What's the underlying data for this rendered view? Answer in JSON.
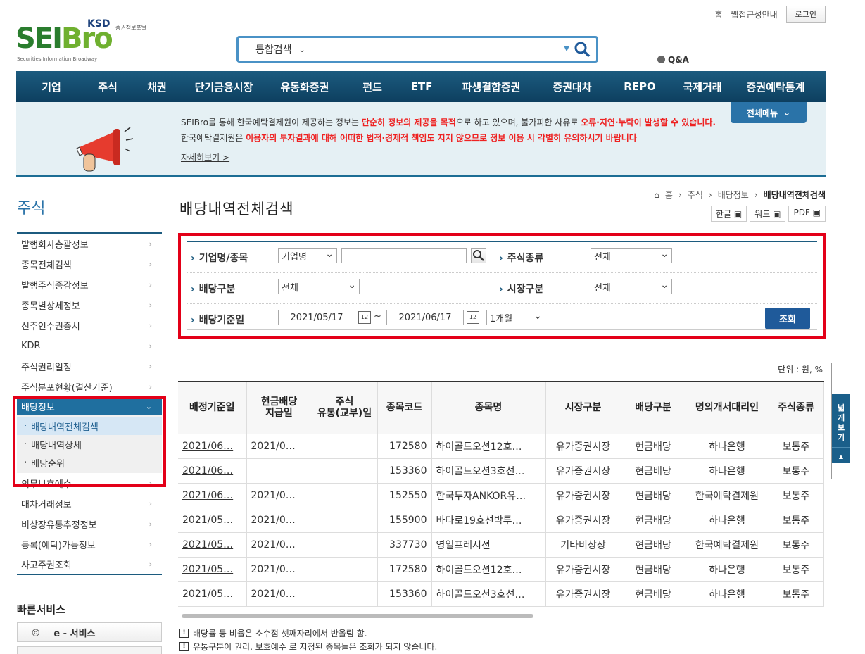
{
  "top": {
    "home": "홈",
    "accessibility": "웹접근성안내",
    "login": "로그인"
  },
  "logo": {
    "text_a": "SEI",
    "text_b": "Bro",
    "ksd": "KSD",
    "ksd_sub": "증권정보포털",
    "tagline": "Securities Information Broadway"
  },
  "search": {
    "scope": "통합검색"
  },
  "qa": "Q&A",
  "gnb": [
    "기업",
    "주식",
    "채권",
    "단기금융시장",
    "유동화증권",
    "펀드",
    "ETF",
    "파생결합증권",
    "증권대차",
    "REPO",
    "국제거래",
    "증권예탁통계"
  ],
  "notice": {
    "l1a": "SEIBro를 통해 한국예탁결제원이 제공하는 정보는 ",
    "l1b": "단순히 정보의 제공을 목적",
    "l1c": "으로 하고 있으며, 불가피한 사유로 ",
    "l1d": "오류·지연·누락이 발생할 수 있습니다.",
    "l2a": "한국예탁결제원은 ",
    "l2b": "이용자의 투자결과에 대해 어떠한 법적·경제적 책임도 지지 않으므로 정보 이용 시 각별히 유의하시기 바랍니다",
    "more": "자세히보기  >",
    "all_menu": "전체메뉴"
  },
  "lnb": {
    "title": "주식",
    "items": [
      "발행회사총괄정보",
      "종목전체검색",
      "발행주식증감정보",
      "종목별상세정보",
      "신주인수권증서",
      "KDR",
      "주식권리일정",
      "주식분포현황(결산기준)"
    ],
    "active": "배당정보",
    "sub": [
      "배당내역전체검색",
      "배당내역상세",
      "배당순위"
    ],
    "items2": [
      "의무보호예수",
      "대차거래정보",
      "비상장유통추정정보",
      "등록(예탁)가능정보",
      "사고주권조회"
    ]
  },
  "quick": {
    "title": "빠른서비스",
    "eservice": "e - 서비스"
  },
  "page": {
    "title": "배당내역전체검색"
  },
  "breadcrumb": {
    "home": "홈",
    "c1": "주식",
    "c2": "배당정보",
    "current": "배당내역전체검색"
  },
  "exports": [
    "한글",
    "워드",
    "PDF"
  ],
  "filter": {
    "company_label": "기업명/종목",
    "company_type": "기업명",
    "company_value": "",
    "stock_kind_label": "주식종류",
    "stock_kind": "전체",
    "div_type_label": "배당구분",
    "div_type": "전체",
    "market_label": "시장구분",
    "market": "전체",
    "date_label": "배당기준일",
    "date_from": "2021/05/17",
    "tilde": "~",
    "date_to": "2021/06/17",
    "period": "1개월",
    "search_btn": "조회"
  },
  "unit": "단위 : 원, %",
  "table": {
    "headers": [
      [
        "배정기준일"
      ],
      [
        "현금배당",
        "지급일"
      ],
      [
        "주식",
        "유통(교부)일"
      ],
      [
        "종목코드"
      ],
      [
        "종목명"
      ],
      [
        "시장구분"
      ],
      [
        "배당구분"
      ],
      [
        "명의개서대리인"
      ],
      [
        "주식종류"
      ]
    ],
    "rows": [
      [
        "2021/06…",
        "2021/0…",
        "",
        "172580",
        "하이골드오션12호…",
        "유가증권시장",
        "현금배당",
        "하나은행",
        "보통주"
      ],
      [
        "2021/06…",
        "",
        "",
        "153360",
        "하이골드오션3호선…",
        "유가증권시장",
        "현금배당",
        "하나은행",
        "보통주"
      ],
      [
        "2021/06…",
        "2021/0…",
        "",
        "152550",
        "한국투자ANKOR유…",
        "유가증권시장",
        "현금배당",
        "한국예탁결제원",
        "보통주"
      ],
      [
        "2021/05…",
        "2021/0…",
        "",
        "155900",
        "바다로19호선박투…",
        "유가증권시장",
        "현금배당",
        "하나은행",
        "보통주"
      ],
      [
        "2021/05…",
        "2021/0…",
        "",
        "337730",
        "영일프레시젼",
        "기타비상장",
        "현금배당",
        "한국예탁결제원",
        "보통주"
      ],
      [
        "2021/05…",
        "2021/0…",
        "",
        "172580",
        "하이골드오션12호…",
        "유가증권시장",
        "현금배당",
        "하나은행",
        "보통주"
      ],
      [
        "2021/05…",
        "2021/0…",
        "",
        "153360",
        "하이골드오션3호선…",
        "유가증권시장",
        "현금배당",
        "하나은행",
        "보통주"
      ]
    ]
  },
  "notes": [
    "배당률 등 비율은 소수점 셋째자리에서 반올림 함.",
    "유통구분이 권리, 보호예수 로 지정된 종목들은 조회가 되지 않습니다."
  ],
  "wide_view": {
    "label": "넓게보기",
    "top": "TOP"
  }
}
